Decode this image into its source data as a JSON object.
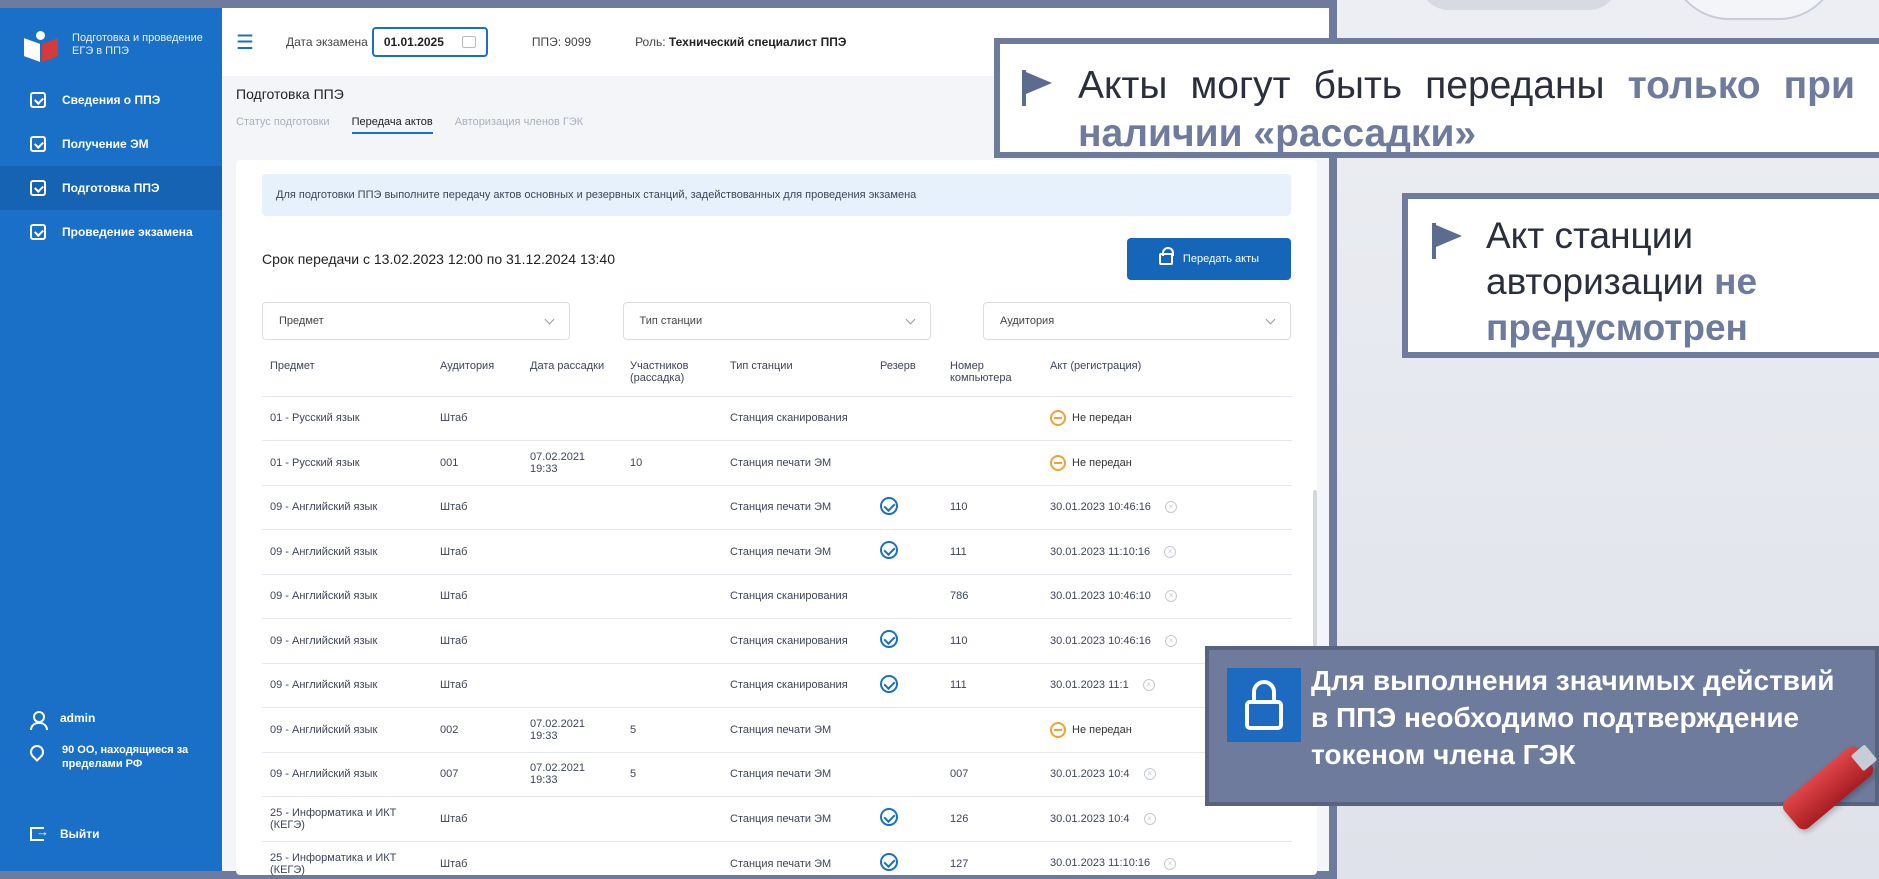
{
  "sidebar": {
    "logo_text": "Подготовка и проведение ЕГЭ в ППЭ",
    "items": [
      {
        "label": "Сведения о ППЭ"
      },
      {
        "label": "Получение ЭМ"
      },
      {
        "label": "Подготовка ППЭ"
      },
      {
        "label": "Проведение экзамена"
      }
    ],
    "user": "admin",
    "region": "90 ОО, находящиеся за пределами РФ",
    "logout": "Выйти"
  },
  "topbar": {
    "date_label": "Дата экзамена",
    "date_value": "01.01.2025",
    "ppe": "ППЭ: 9099",
    "role_label": "Роль:",
    "role_value": "Технический специалист ППЭ"
  },
  "page": {
    "title": "Подготовка ППЭ",
    "tabs": [
      {
        "label": "Статус подготовки"
      },
      {
        "label": "Передача актов"
      },
      {
        "label": "Авторизация членов ГЭК"
      }
    ]
  },
  "info_text": "Для подготовки ППЭ выполните передачу актов основных и резервных станций, задействованных для проведения экзамена",
  "deadline": "Срок передачи с 13.02.2023 12:00 по 31.12.2024 13:40",
  "send_button": "Передать акты",
  "filters": {
    "subject": "Предмет",
    "station_type": "Тип станции",
    "auditorium": "Аудитория"
  },
  "table": {
    "headers": [
      "Предмет",
      "Аудитория",
      "Дата рассадки",
      "Участников (рассадка)",
      "Тип станции",
      "Резерв",
      "Номер компьютера",
      "Акт (регистрация)"
    ],
    "rows": [
      {
        "subject": "01 - Русский язык",
        "aud": "Штаб",
        "date": "",
        "count": "",
        "type": "Станция сканирования",
        "reserve": "",
        "pc": "",
        "act": "Не передан"
      },
      {
        "subject": "01 - Русский язык",
        "aud": "001",
        "date": "07.02.2021 19:33",
        "count": "10",
        "type": "Станция печати ЭМ",
        "reserve": "",
        "pc": "",
        "act": "Не передан"
      },
      {
        "subject": "09 - Английский язык",
        "aud": "Штаб",
        "date": "",
        "count": "",
        "type": "Станция печати ЭМ",
        "reserve": "✓",
        "pc": "110",
        "act": "30.01.2023 10:46:16"
      },
      {
        "subject": "09 - Английский язык",
        "aud": "Штаб",
        "date": "",
        "count": "",
        "type": "Станция печати ЭМ",
        "reserve": "✓",
        "pc": "111",
        "act": "30.01.2023 11:10:16"
      },
      {
        "subject": "09 - Английский язык",
        "aud": "Штаб",
        "date": "",
        "count": "",
        "type": "Станция сканирования",
        "reserve": "",
        "pc": "786",
        "act": "30.01.2023 10:46:10"
      },
      {
        "subject": "09 - Английский язык",
        "aud": "Штаб",
        "date": "",
        "count": "",
        "type": "Станция сканирования",
        "reserve": "✓",
        "pc": "110",
        "act": "30.01.2023 10:46:16"
      },
      {
        "subject": "09 - Английский язык",
        "aud": "Штаб",
        "date": "",
        "count": "",
        "type": "Станция сканирования",
        "reserve": "✓",
        "pc": "111",
        "act": "30.01.2023 11:1"
      },
      {
        "subject": "09 - Английский язык",
        "aud": "002",
        "date": "07.02.2021 19:33",
        "count": "5",
        "type": "Станция печати ЭМ",
        "reserve": "",
        "pc": "",
        "act": "Не передан"
      },
      {
        "subject": "09 - Английский язык",
        "aud": "007",
        "date": "07.02.2021 19:33",
        "count": "5",
        "type": "Станция печати ЭМ",
        "reserve": "",
        "pc": "007",
        "act": "30.01.2023 10:4"
      },
      {
        "subject": "25 - Информатика и ИКТ (КЕГЭ)",
        "aud": "Штаб",
        "date": "",
        "count": "",
        "type": "Станция печати ЭМ",
        "reserve": "✓",
        "pc": "126",
        "act": "30.01.2023 10:4"
      },
      {
        "subject": "25 - Информатика и ИКТ (КЕГЭ)",
        "aud": "Штаб",
        "date": "",
        "count": "",
        "type": "Станция печати ЭМ",
        "reserve": "✓",
        "pc": "127",
        "act": "30.01.2023 11:10:16"
      }
    ]
  },
  "callouts": {
    "c1_text": "Акты могут быть переданы ",
    "c1_bold": "только при наличии «рассадки»",
    "c2_text": "Акт станции авторизации ",
    "c2_bold": "не предусмотрен",
    "c3_text": "Для выполнения значимых действий в ППЭ необходимо подтверждение токеном члена ГЭК"
  }
}
